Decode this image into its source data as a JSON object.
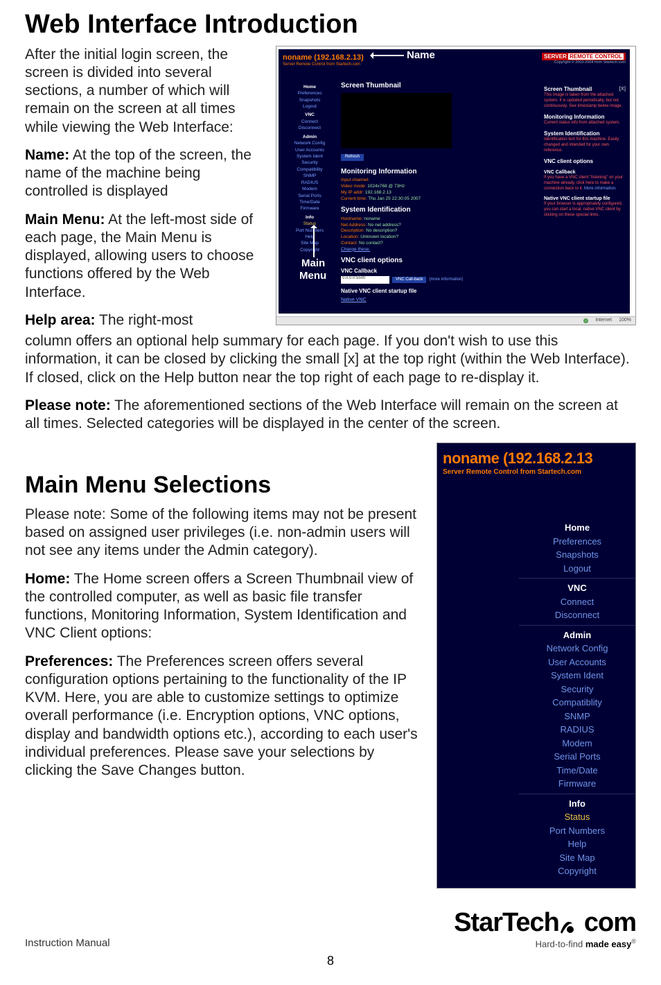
{
  "heading1": "Web Interface Introduction",
  "intro_p1": "After the initial login screen, the screen is divided into several sections, a number of which will remain on the screen at all times while viewing the Web Interface:",
  "name_label": "Name:",
  "name_text": " At the top of the screen, the name of the machine being controlled is displayed",
  "mainmenu_label": "Main Menu:",
  "mainmenu_text": " At the left-most side of each page, the Main Menu is displayed, allowing users to choose functions offered by the Web Interface.",
  "help_label": "Help area:",
  "help_text_first": " The right-most",
  "help_p_rest": "column offers an optional help summary for each page. If you don't wish to use this information, it can be closed by clicking the small [x] at the top right (within the Web Interface). If closed, click on the Help button near the top right of each page to re-display it.",
  "note_label": "Please note:",
  "note_text": " The aforementioned sections of the Web Interface will remain on the screen at all times. Selected categories will be displayed in the center of the screen.",
  "heading2": "Main Menu Selections",
  "mms_intro": "Please note: Some of the following items may not be present based on assigned user privileges (i.e. non-admin users will not see any items under the Admin category).",
  "home_label": "Home:",
  "home_text": " The Home screen offers a Screen Thumbnail view of the controlled computer, as well as basic file transfer functions, Monitoring Information, System Identification and VNC Client options:",
  "pref_label": "Preferences:",
  "pref_text": " The Preferences screen offers several configuration options pertaining to the functionality of the IP KVM. Here, you are able to customize settings to optimize overall performance (i.e. Encryption options, VNC options, display and bandwidth options etc.), according to each user's individual preferences. Please save your selections by clicking the Save Changes button.",
  "footer_left": "Instruction Manual",
  "page_number": "8",
  "logo_text": "StarTech",
  "logo_suffix": "com",
  "tagline_a": "Hard-to-find ",
  "tagline_b": "made easy",
  "ann_name": "Name",
  "ann_main": "Main",
  "ann_menu": "Menu",
  "shot1": {
    "host": "noname (192.168.2.13)",
    "sub": "Server Remote Control from Startech.com",
    "badge_a": "SERVER",
    "badge_b": "REMOTE CONTROL",
    "copy": "Copyright © 2003-2004 from Startech.com",
    "menu": {
      "g1h": "Home",
      "g1": [
        "Preferences",
        "Snapshots",
        "Logout"
      ],
      "g2h": "VNC",
      "g2": [
        "Connect",
        "Disconnect"
      ],
      "g3h": "Admin",
      "g3": [
        "Network Config",
        "User Accounts",
        "System Ident",
        "Security",
        "Compatibility",
        "SNMP",
        "RADIUS",
        "Modem",
        "Serial Ports",
        "Time/Date",
        "Firmware"
      ],
      "g4h": "Info",
      "g4": [
        "Status",
        "Port Numbers",
        "Help",
        "Site Map",
        "Copyright"
      ]
    },
    "center": {
      "h_thumb": "Screen Thumbnail",
      "refresh": "Refresh",
      "h_mon": "Monitoring Information",
      "mon_k1": "Input channel:",
      "mon_v1": "",
      "mon_k2": "Video mode:",
      "mon_v2": " 1024x768 @ 73Hz",
      "mon_k3": "My IP addr:",
      "mon_v3": " 192.168.2.13",
      "mon_k4": "Current time:",
      "mon_v4": " Thu Jan 25 22:30:05 2007",
      "h_sys": "System Identification",
      "sys_k1": "Hostname:",
      "sys_v1": " noname",
      "sys_k2": "Net Address:",
      "sys_v2": " No net address?",
      "sys_k3": "Description:",
      "sys_v3": " No description?",
      "sys_k4": "Location:",
      "sys_v4": " Unknown location?",
      "sys_k5": "Contact:",
      "sys_v5": " No contact?",
      "sys_change": "Change these.",
      "h_vnc": "VNC client options",
      "h_cb": "VNC Callback",
      "input_val": "0.0.0.0:5500",
      "btn_cb": "VNC Call-back",
      "more": "(more information)",
      "h_native": "Native VNC client startup file",
      "native_link": "Native VNC"
    },
    "help": {
      "h1": "Screen Thumbnail",
      "close": "[X]",
      "p1": "This image is taken from the attached system. It is updated periodically, but not continuously. See timestamp below image.",
      "h2": "Monitoring Information",
      "p2": "Current status info from attached system.",
      "h3": "System Identification",
      "p3": "Identification text for this machine. Easily changed and intended for your own reference.",
      "h4": "VNC client options",
      "h5": "VNC Callback",
      "p5a": "If you have a VNC client \"listening\" on your machine already, click here to make a connection back to it. ",
      "p5b": "More information.",
      "h6": "Native VNC client startup file",
      "p6a": "If your browser is appropriately configured, you can start a local, native VNC client by clicking on these special links."
    },
    "status_internet": "Internet",
    "status_zoom": "100%"
  },
  "shot2": {
    "host": "noname (192.168.2.13",
    "sub": "Server Remote Control from Startech.com",
    "g1h": "Home",
    "g1": [
      "Preferences",
      "Snapshots",
      "Logout"
    ],
    "g2h": "VNC",
    "g2": [
      "Connect",
      "Disconnect"
    ],
    "g3h": "Admin",
    "g3": [
      "Network Config",
      "User Accounts",
      "System Ident",
      "Security",
      "Compatiblity",
      "SNMP",
      "RADIUS",
      "Modem",
      "Serial Ports",
      "Time/Date",
      "Firmware"
    ],
    "g4h": "Info",
    "g4": [
      "Status",
      "Port Numbers",
      "Help",
      "Site Map",
      "Copyright"
    ]
  }
}
